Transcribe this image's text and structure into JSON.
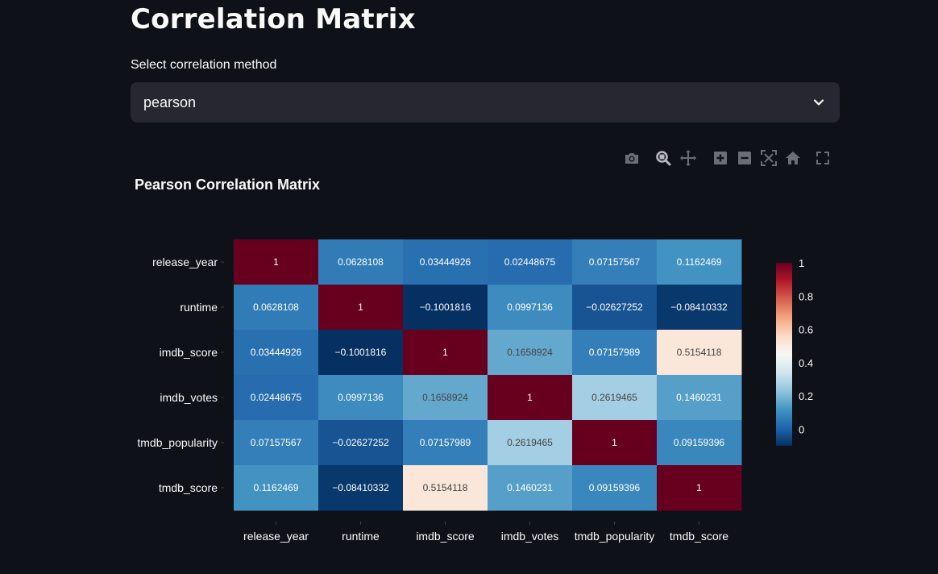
{
  "page": {
    "title": "Correlation Matrix",
    "select_label": "Select correlation method",
    "select_value": "pearson"
  },
  "modebar": {
    "icons": [
      "camera-icon",
      "zoom-icon",
      "pan-icon",
      "zoom-in-icon",
      "zoom-out-icon",
      "autoscale-icon",
      "home-icon",
      "fullscreen-icon"
    ]
  },
  "colors": {
    "background": "#0e1117",
    "select_bg": "#262730",
    "colorscale": [
      "#053061",
      "#2166ac",
      "#4393c3",
      "#92c5de",
      "#d1e5f0",
      "#f7f7f7",
      "#fddbc7",
      "#f4a582",
      "#d6604d",
      "#b2182b",
      "#67001f"
    ]
  },
  "chart_data": {
    "type": "heatmap",
    "title": "Pearson Correlation Matrix",
    "x_labels": [
      "release_year",
      "runtime",
      "imdb_score",
      "imdb_votes",
      "tmdb_popularity",
      "tmdb_score"
    ],
    "y_labels": [
      "release_year",
      "runtime",
      "imdb_score",
      "imdb_votes",
      "tmdb_popularity",
      "tmdb_score"
    ],
    "z": [
      [
        1,
        0.0628108,
        0.03444926,
        0.02448675,
        0.07157567,
        0.1162469
      ],
      [
        0.0628108,
        1,
        -0.1001816,
        0.0997136,
        -0.02627252,
        -0.08410332
      ],
      [
        0.03444926,
        -0.1001816,
        1,
        0.1658924,
        0.07157989,
        0.5154118
      ],
      [
        0.02448675,
        0.0997136,
        0.1658924,
        1,
        0.2619465,
        0.1460231
      ],
      [
        0.07157567,
        -0.02627252,
        0.07157989,
        0.2619465,
        1,
        0.09159396
      ],
      [
        0.1162469,
        -0.08410332,
        0.5154118,
        0.1460231,
        0.09159396,
        1
      ]
    ],
    "text": [
      [
        "1",
        "0.0628108",
        "0.03444926",
        "0.02448675",
        "0.07157567",
        "0.1162469"
      ],
      [
        "0.0628108",
        "1",
        "−0.1001816",
        "0.0997136",
        "−0.02627252",
        "−0.08410332"
      ],
      [
        "0.03444926",
        "−0.1001816",
        "1",
        "0.1658924",
        "0.07157989",
        "0.5154118"
      ],
      [
        "0.02448675",
        "0.0997136",
        "0.1658924",
        "1",
        "0.2619465",
        "0.1460231"
      ],
      [
        "0.07157567",
        "−0.02627252",
        "0.07157989",
        "0.2619465",
        "1",
        "0.09159396"
      ],
      [
        "0.1162469",
        "−0.08410332",
        "0.5154118",
        "0.1460231",
        "0.09159396",
        "1"
      ]
    ],
    "zlim": [
      -0.1001816,
      1
    ],
    "colorbar_ticks": [
      "1",
      "0.8",
      "0.6",
      "0.4",
      "0.2",
      "0"
    ],
    "colorbar_tick_values": [
      1,
      0.8,
      0.6,
      0.4,
      0.2,
      0
    ],
    "colorscale_name": "RdBu_r",
    "legend": "right"
  }
}
